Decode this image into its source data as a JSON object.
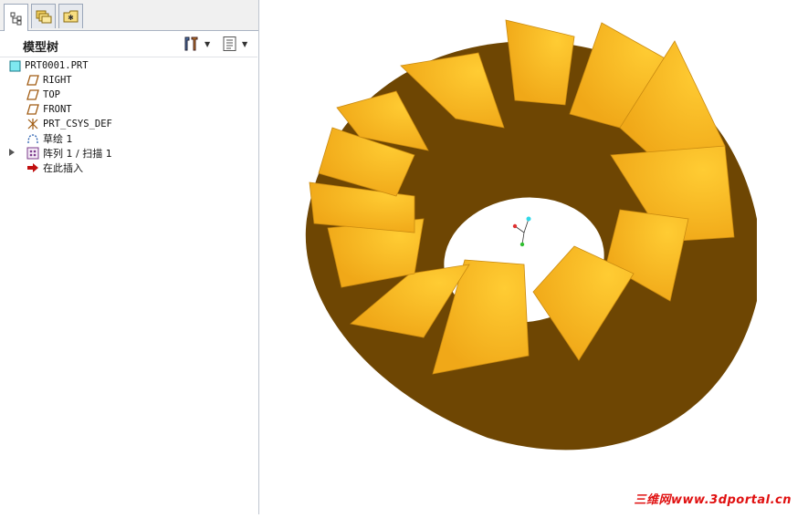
{
  "tabs": [
    {
      "name": "model-tree-tab",
      "icon": "tree-icon"
    },
    {
      "name": "layers-tab",
      "icon": "folders-icon"
    },
    {
      "name": "favorites-tab",
      "icon": "star-folder-icon"
    }
  ],
  "model_tree": {
    "title": "模型树",
    "items": [
      {
        "label": "PRT0001.PRT",
        "icon": "part-icon"
      },
      {
        "label": "RIGHT",
        "icon": "datum-plane-icon"
      },
      {
        "label": "TOP",
        "icon": "datum-plane-icon"
      },
      {
        "label": "FRONT",
        "icon": "datum-plane-icon"
      },
      {
        "label": "PRT_CSYS_DEF",
        "icon": "csys-icon"
      },
      {
        "label": "草绘 1",
        "icon": "sketch-icon"
      },
      {
        "label": "阵列 1 / 扫描 1",
        "icon": "pattern-icon"
      },
      {
        "label": "在此插入",
        "icon": "insert-arrow-icon"
      }
    ]
  },
  "watermark": "三维网www.3dportal.cn",
  "colors": {
    "gear_light": "#ffcc33",
    "gear_mid": "#f0a818",
    "gear_dark": "#6e4603",
    "watermark": "#e01010"
  }
}
